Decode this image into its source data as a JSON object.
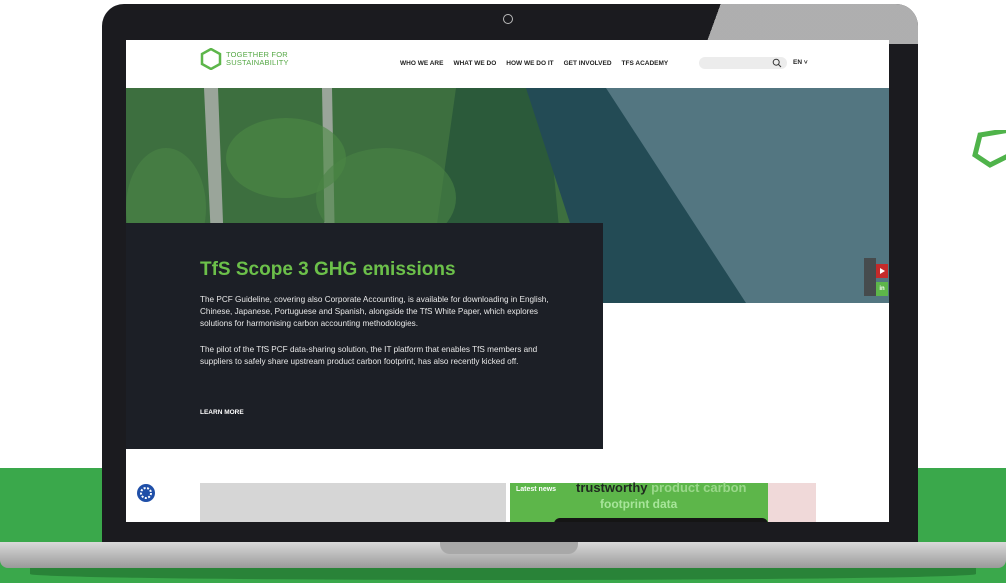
{
  "brand": {
    "line1": "TOGETHER FOR",
    "line2": "SUSTAINABILITY",
    "color": "#55a845"
  },
  "nav": {
    "items": [
      "WHO WE ARE",
      "WHAT WE DO",
      "HOW WE DO IT",
      "GET INVOLVED",
      "TFS ACADEMY"
    ],
    "search_placeholder": "",
    "language": "EN"
  },
  "hero": {
    "title": "TfS Scope 3 GHG emissions",
    "paragraph1": "The PCF Guideline, covering also Corporate Accounting, is available for downloading in English, Chinese, Japanese, Portuguese and Spanish, alongside the TfS White Paper, which explores solutions for harmonising carbon accounting methodologies.",
    "paragraph2": "The pilot of the TfS PCF data-sharing solution, the IT platform that enables TfS members and suppliers to safely share upstream product carbon footprint, has also recently kicked off.",
    "cta": "LEARN MORE"
  },
  "social": {
    "linkedin": "in"
  },
  "news": {
    "badge": "Latest news",
    "headline_dark": "trustworthy",
    "headline_light": " product carbon",
    "headline_line2": "footprint data"
  },
  "colors": {
    "accent": "#6cc04a",
    "panel": "#1c1f26",
    "background_band": "#3aa84b"
  }
}
